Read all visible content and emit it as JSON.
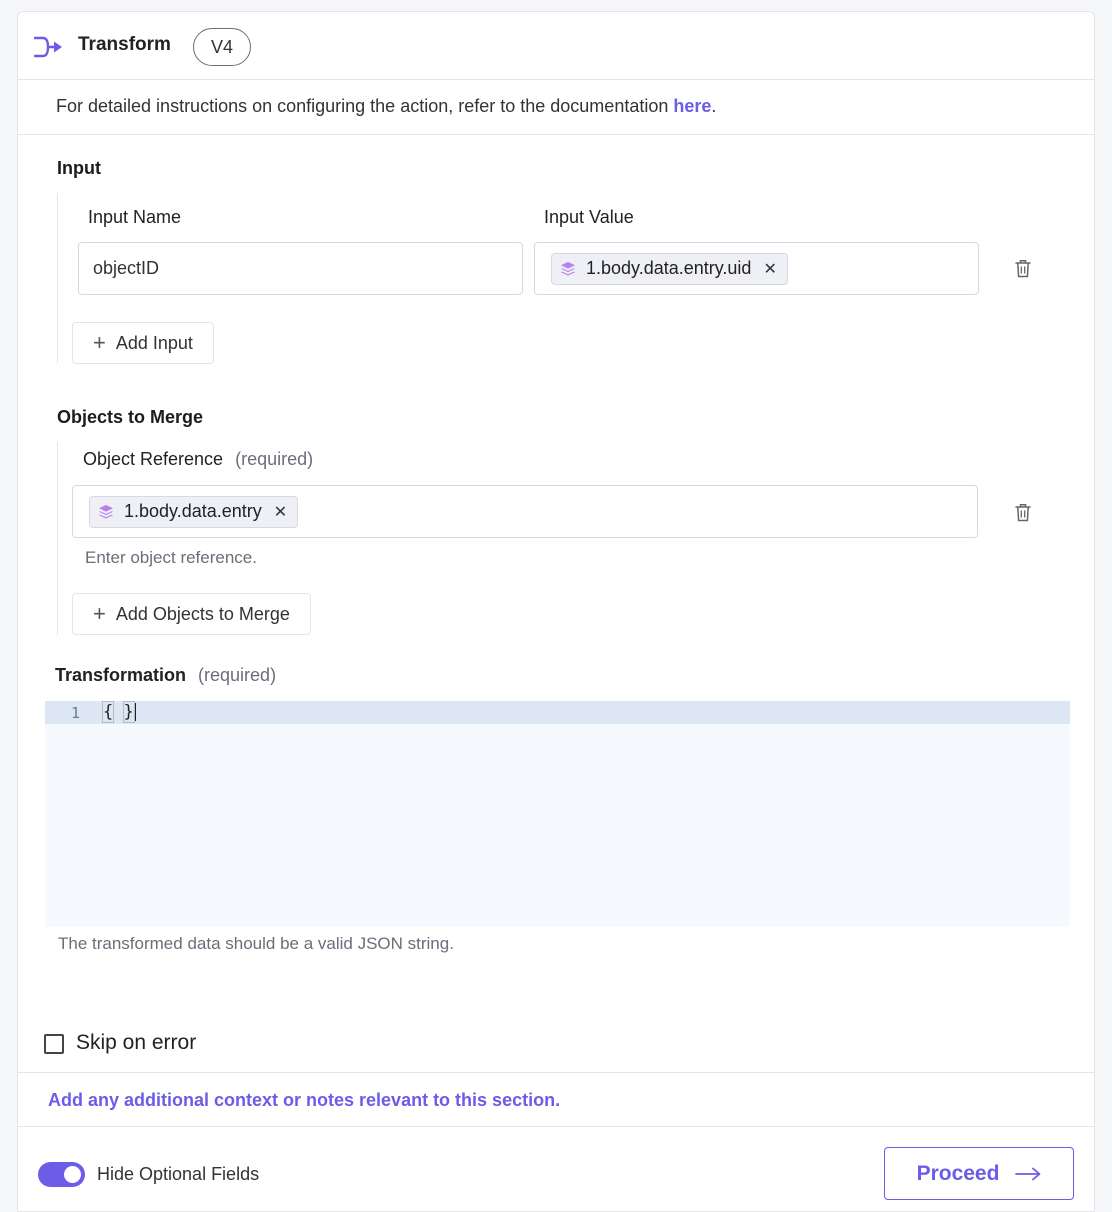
{
  "header": {
    "title": "Transform",
    "version": "V4",
    "icon": "transform-arrow-icon"
  },
  "info": {
    "text": "For detailed instructions on configuring the action, refer to the documentation ",
    "link": "here",
    "suffix": "."
  },
  "input_section": {
    "title": "Input",
    "name_label": "Input Name",
    "value_label": "Input Value",
    "name_value": "objectID",
    "value_chip": "1.body.data.entry.uid",
    "add_label": "Add Input"
  },
  "merge_section": {
    "title": "Objects to Merge",
    "ref_label": "Object Reference",
    "required": "(required)",
    "ref_chip": "1.body.data.entry",
    "helper": "Enter object reference.",
    "add_label": "Add Objects to Merge"
  },
  "transformation": {
    "label": "Transformation",
    "required": "(required)",
    "line_number": "1",
    "code_open": "{",
    "code_close": "}",
    "helper": "The transformed data should be a valid JSON string."
  },
  "skip_on_error": {
    "label": "Skip on error",
    "checked": false
  },
  "notes": {
    "link": "Add any additional context or notes relevant to this section."
  },
  "footer": {
    "toggle_label": "Hide Optional Fields",
    "toggle_on": true,
    "proceed_label": "Proceed"
  },
  "colors": {
    "accent": "#6c5ce7",
    "chip_icon": "#b77ff0",
    "border": "#e3e5ea"
  }
}
